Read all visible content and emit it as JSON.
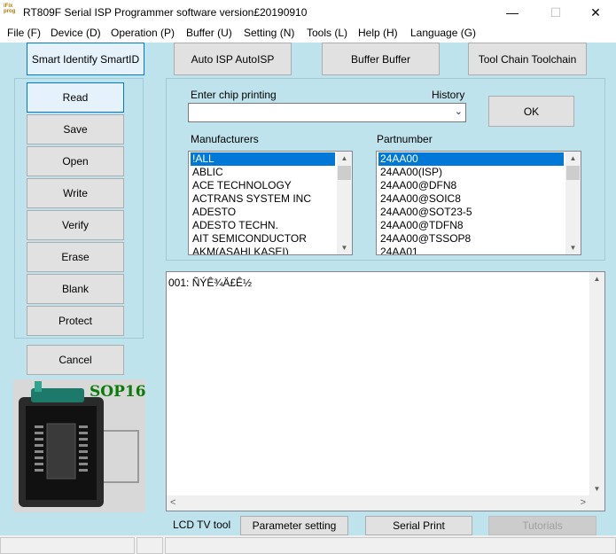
{
  "window": {
    "title": "RT809F Serial ISP Programmer software version£20190910",
    "icon_text": "iFix prog",
    "minimize": "—",
    "maximize": "☐",
    "close": "✕"
  },
  "menu": [
    "File (F)",
    "Device (D)",
    "Operation (P)",
    "Buffer (U)",
    "Setting (N)",
    "Tools (L)",
    "Help (H)",
    "Language (G)"
  ],
  "top_buttons": {
    "smart_identify": "Smart Identify SmartID",
    "auto_isp": "Auto ISP AutoISP",
    "buffer": "Buffer Buffer",
    "tool_chain": "Tool Chain Toolchain"
  },
  "side_buttons": {
    "read": "Read",
    "save": "Save",
    "open": "Open",
    "write": "Write",
    "verify": "Verify",
    "erase": "Erase",
    "blank": "Blank",
    "protect": "Protect",
    "cancel": "Cancel"
  },
  "chip": {
    "enter_label": "Enter chip printing",
    "history_label": "History",
    "value": "",
    "ok_label": "OK"
  },
  "manufacturers": {
    "label": "Manufacturers",
    "items": [
      "!ALL",
      "ABLIC",
      "ACE TECHNOLOGY",
      "ACTRANS SYSTEM INC",
      "ADESTO",
      "ADESTO TECHN.",
      "AIT SEMICONDUCTOR",
      "AKM(ASAHI KASEI)"
    ],
    "selected": "!ALL"
  },
  "partnumbers": {
    "label": "Partnumber",
    "items": [
      "24AA00",
      "24AA00(ISP)",
      "24AA00@DFN8",
      "24AA00@SOIC8",
      "24AA00@SOT23-5",
      "24AA00@TDFN8",
      "24AA00@TSSOP8",
      "24AA01"
    ],
    "selected": "24AA00"
  },
  "log": {
    "line": "001:  ÑÝÊ¾Ä£Ê½"
  },
  "package_image": {
    "label": "SOP16"
  },
  "bottom": {
    "lcd_label": "LCD TV tool",
    "parameter_setting": "Parameter setting",
    "serial_print": "Serial Print",
    "tutorials": "Tutorials"
  },
  "colors": {
    "background": "#bfe3ec",
    "selection": "#0078d7",
    "package_label": "#0a7a0a"
  }
}
